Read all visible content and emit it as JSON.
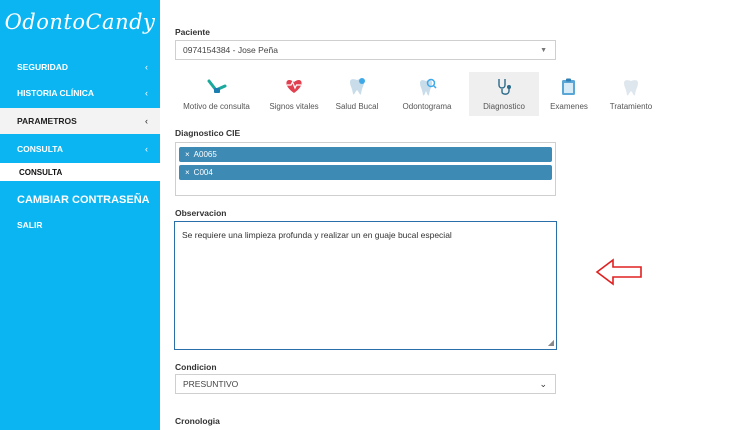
{
  "app": {
    "logo_text": "OdontoCandy"
  },
  "sidebar": {
    "items": [
      {
        "label": "SEGURIDAD"
      },
      {
        "label": "HISTORIA CLÍNICA"
      },
      {
        "label": "PARAMETROS"
      },
      {
        "label": "CONSULTA"
      },
      {
        "label": "Consulta"
      },
      {
        "label": "CAMBIAR CONTRASEÑA"
      },
      {
        "label": "SALIR"
      }
    ],
    "chevron": "‹"
  },
  "patient": {
    "label": "Paciente",
    "value": "0974154384 - Jose Peña"
  },
  "tabs": [
    {
      "label": "Motivo de consulta",
      "icon": "dental-tool-icon"
    },
    {
      "label": "Signos vitales",
      "icon": "heart-pulse-icon"
    },
    {
      "label": "Salud Bucal",
      "icon": "tooth-icon"
    },
    {
      "label": "Odontograma",
      "icon": "tooth-search-icon"
    },
    {
      "label": "Diagnostico",
      "icon": "stethoscope-icon"
    },
    {
      "label": "Examenes",
      "icon": "clipboard-icon"
    },
    {
      "label": "Tratamiento",
      "icon": "tooth-icon"
    }
  ],
  "diagnostico": {
    "label": "Diagnostico CIE",
    "tags": [
      "A0065",
      "C004"
    ]
  },
  "observacion": {
    "label": "Observacion",
    "value": "Se requiere una limpieza profunda y realizar un en guaje bucal especial"
  },
  "condicion": {
    "label": "Condicion",
    "value": "PRESUNTIVO"
  },
  "cronologia": {
    "label": "Cronologia"
  },
  "colors": {
    "sidebar": "#0bb5f2",
    "tag": "#3d8ab5",
    "arrow": "#e02020"
  }
}
